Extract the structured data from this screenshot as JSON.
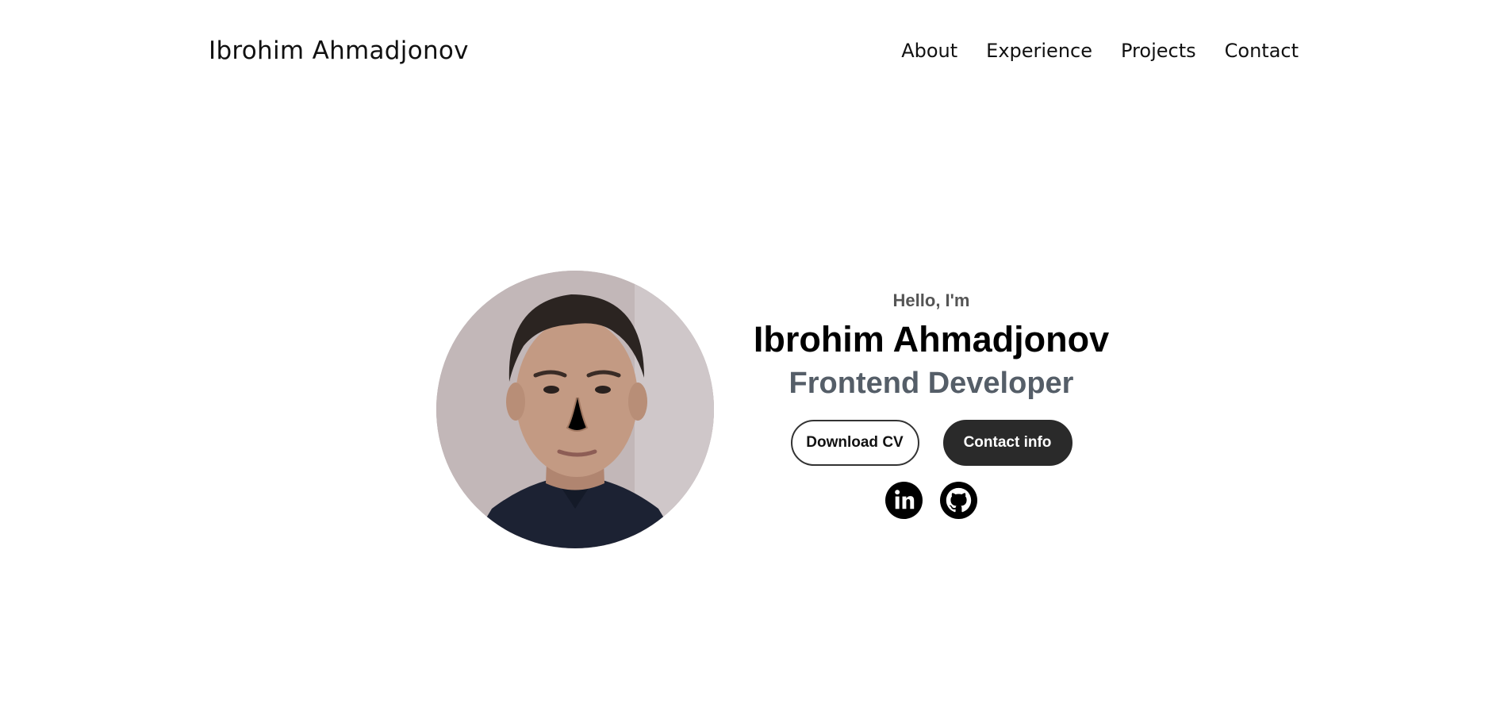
{
  "header": {
    "logo": "Ibrohim Ahmadjonov",
    "nav": [
      {
        "label": "About"
      },
      {
        "label": "Experience"
      },
      {
        "label": "Projects"
      },
      {
        "label": "Contact"
      }
    ]
  },
  "hero": {
    "greeting": "Hello, I'm",
    "name": "Ibrohim Ahmadjonov",
    "role": "Frontend Developer",
    "buttons": {
      "download_label": "Download CV",
      "contact_label": "Contact info"
    },
    "socials": [
      {
        "icon": "linkedin-icon"
      },
      {
        "icon": "github-icon"
      }
    ]
  },
  "colors": {
    "text": "#111111",
    "muted": "#555e68",
    "button_dark": "#2a2a2a",
    "background": "#ffffff"
  }
}
